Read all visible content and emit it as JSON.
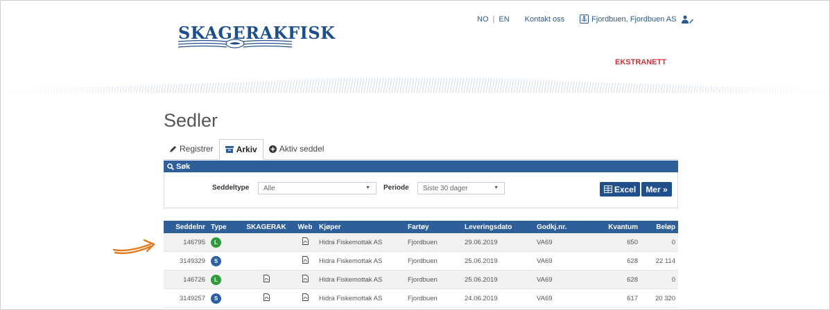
{
  "header": {
    "logo_text": "SKAGERAKFISK",
    "lang_no": "NO",
    "lang_sep": "|",
    "lang_en": "EN",
    "contact": "Kontakt oss",
    "user_name": "Fjordbuen, Fjordbuen AS",
    "ekstranett": "EKSTRANETT"
  },
  "page": {
    "title": "Sedler",
    "tabs": [
      {
        "label": "Registrer",
        "icon": "pencil-icon"
      },
      {
        "label": "Arkiv",
        "icon": "archive-icon"
      },
      {
        "label": "Aktiv seddel",
        "icon": "plus-circle-icon"
      }
    ]
  },
  "search": {
    "title": "Søk",
    "seddeltype_label": "Seddeltype",
    "seddeltype_value": "Alle",
    "periode_label": "Periode",
    "periode_value": "Siste 30 dager",
    "excel_label": "Excel",
    "mer_label": "Mer »"
  },
  "table": {
    "headers": [
      "Seddelnr",
      "Type",
      "SKAGERAK",
      "Web",
      "Kjøper",
      "Fartøy",
      "Leveringsdato",
      "Godkj.nr.",
      "Kvantum",
      "Beløp"
    ],
    "rows": [
      {
        "seddelnr": "146795",
        "type": "L",
        "type_color": "#2e9a38",
        "skagerak_pdf": false,
        "web_pdf": true,
        "kjoper": "Hidra Fiskemottak AS",
        "fartoy": "Fjordbuen",
        "dato": "29.06.2019",
        "godkj": "VA69",
        "kvantum": "650",
        "belop": "0"
      },
      {
        "seddelnr": "3149329",
        "type": "S",
        "type_color": "#2b5ea3",
        "skagerak_pdf": false,
        "web_pdf": true,
        "kjoper": "Hidra Fiskemottak AS",
        "fartoy": "Fjordbuen",
        "dato": "25.06.2019",
        "godkj": "VA69",
        "kvantum": "628",
        "belop": "22 114"
      },
      {
        "seddelnr": "146726",
        "type": "L",
        "type_color": "#2e9a38",
        "skagerak_pdf": true,
        "web_pdf": true,
        "kjoper": "Hidra Fiskemottak AS",
        "fartoy": "Fjordbuen",
        "dato": "25.06.2019",
        "godkj": "VA69",
        "kvantum": "628",
        "belop": "0"
      },
      {
        "seddelnr": "3149257",
        "type": "S",
        "type_color": "#2b5ea3",
        "skagerak_pdf": true,
        "web_pdf": true,
        "kjoper": "Hidra Fiskemottak AS",
        "fartoy": "Fjordbuen",
        "dato": "24.06.2019",
        "godkj": "VA69",
        "kvantum": "617",
        "belop": "20 320"
      }
    ]
  },
  "colors": {
    "brand_blue": "#2f5f9b",
    "accent_red": "#d0303a",
    "arrow_orange": "#e07b1e"
  }
}
